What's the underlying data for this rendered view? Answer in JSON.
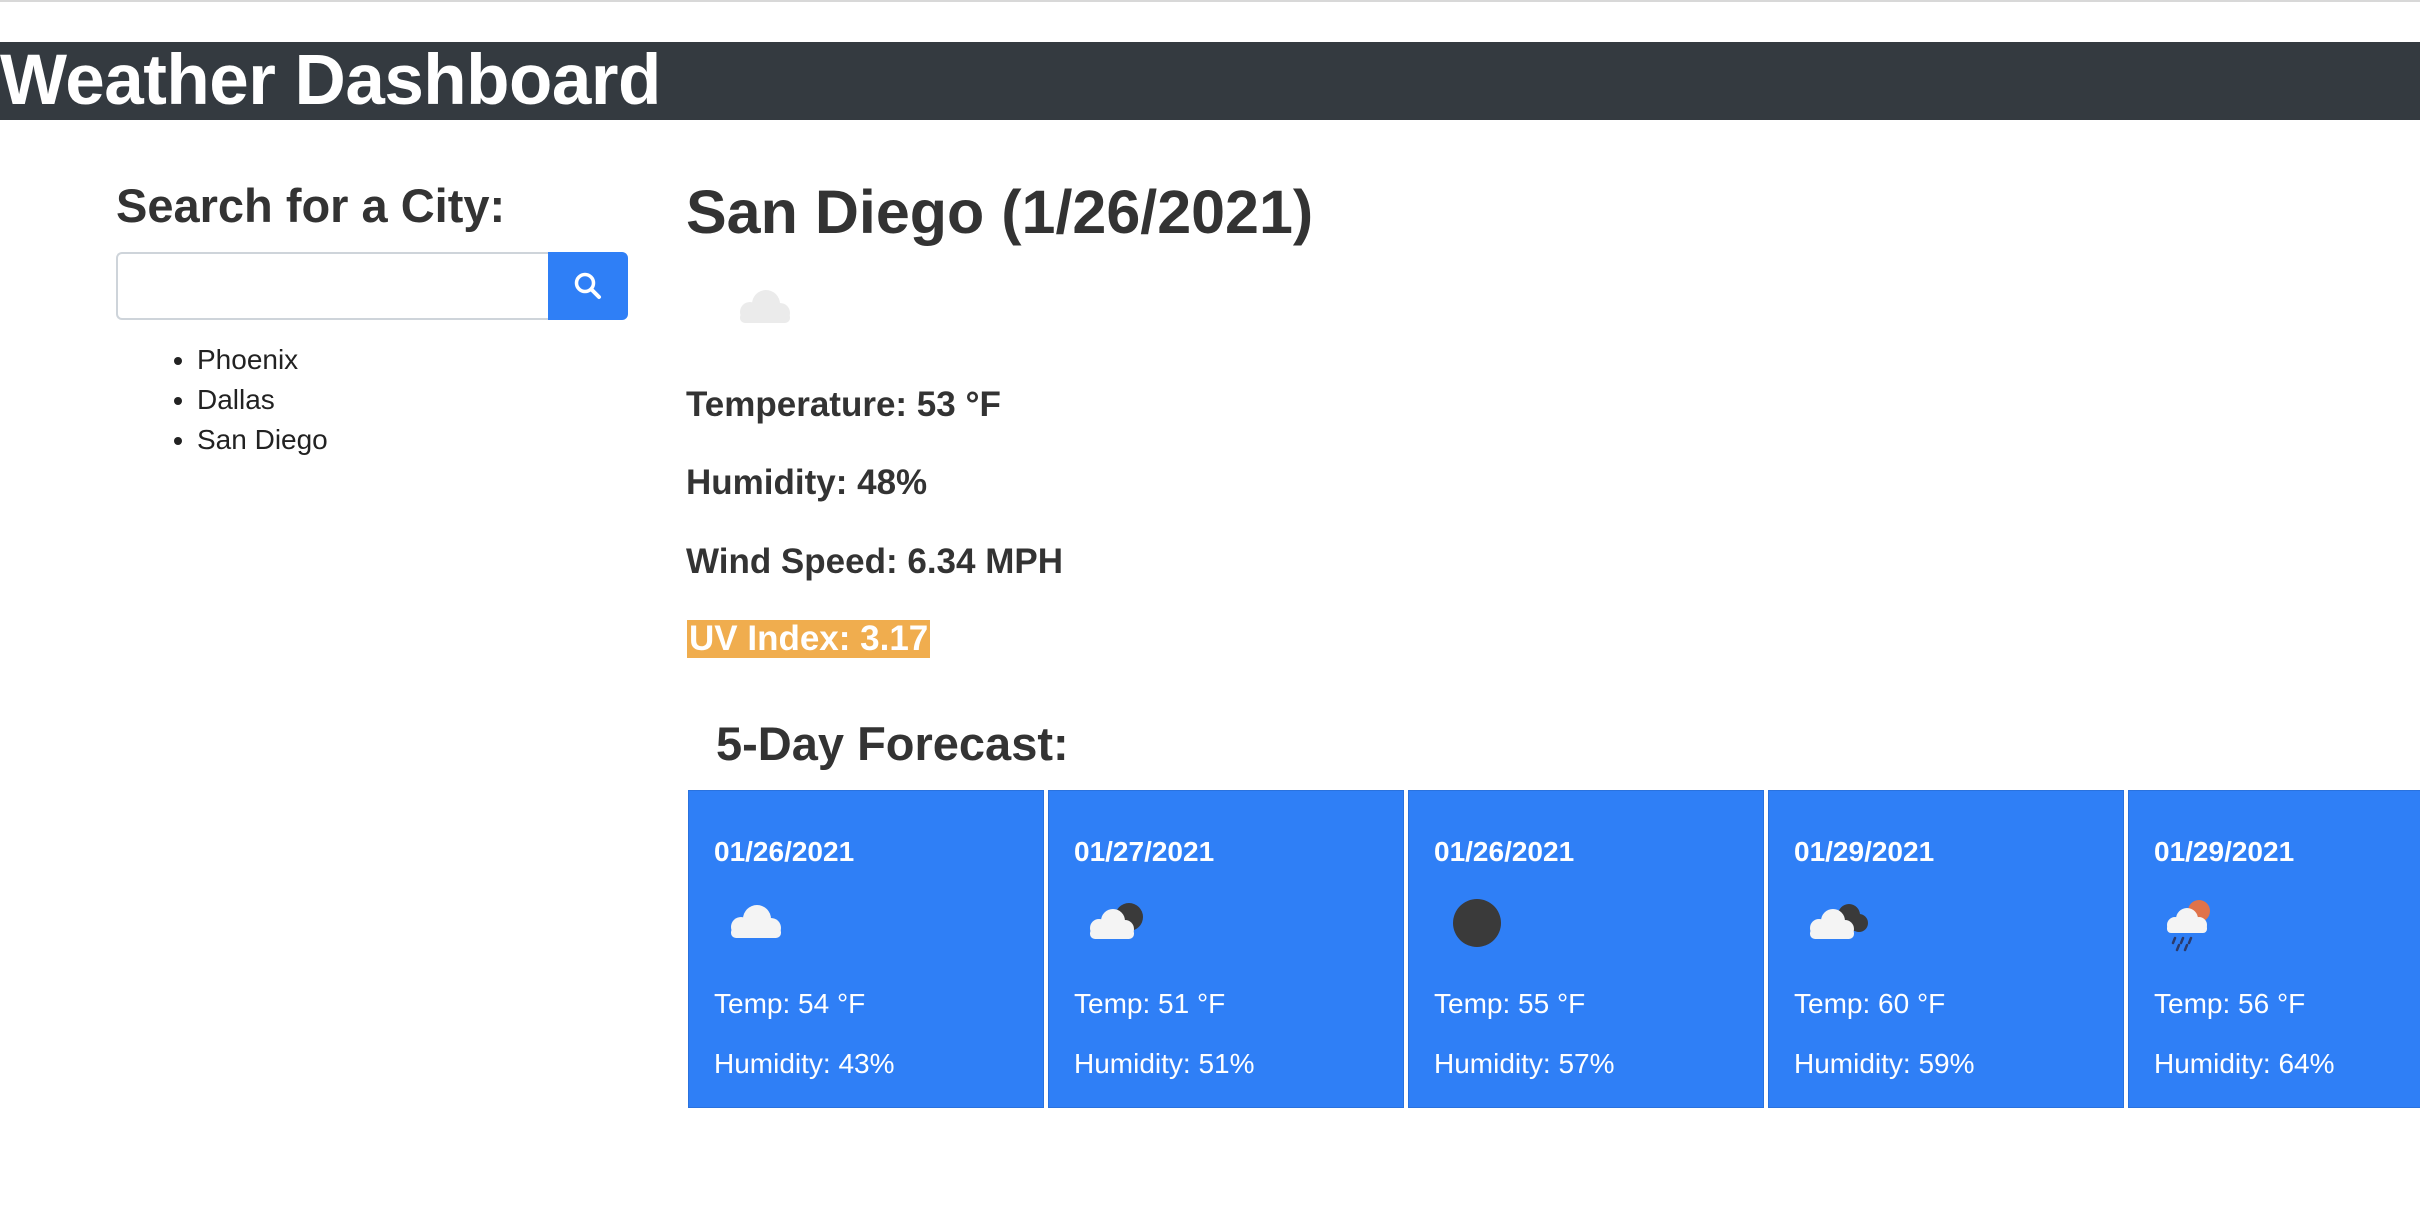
{
  "header": {
    "title": "Weather Dashboard"
  },
  "search": {
    "title": "Search for a City:",
    "input_value": "",
    "button_icon": "search-icon",
    "history": [
      "Phoenix",
      "Dallas",
      "San Diego"
    ]
  },
  "current": {
    "title": "San Diego (1/26/2021)",
    "icon": "cloud-icon",
    "temperature": "Temperature: 53 °F",
    "humidity": "Humidity: 48%",
    "wind": "Wind Speed: 6.34 MPH",
    "uv": "UV Index: 3.17",
    "uv_color": "#f0ad4e"
  },
  "forecast": {
    "title": "5-Day Forecast:",
    "card_color": "#2f7ff6",
    "days": [
      {
        "date": "01/26/2021",
        "icon": "cloud-icon",
        "temp": "Temp: 54 °F",
        "humidity": "Humidity: 43%"
      },
      {
        "date": "01/27/2021",
        "icon": "cloudy-night-icon",
        "temp": "Temp: 51 °F",
        "humidity": "Humidity: 51%"
      },
      {
        "date": "01/26/2021",
        "icon": "moon-icon",
        "temp": "Temp: 55 °F",
        "humidity": "Humidity: 57%"
      },
      {
        "date": "01/29/2021",
        "icon": "broken-clouds-icon",
        "temp": "Temp: 60 °F",
        "humidity": "Humidity: 59%"
      },
      {
        "date": "01/29/2021",
        "icon": "rain-sun-icon",
        "temp": "Temp: 56 °F",
        "humidity": "Humidity: 64%"
      }
    ]
  }
}
